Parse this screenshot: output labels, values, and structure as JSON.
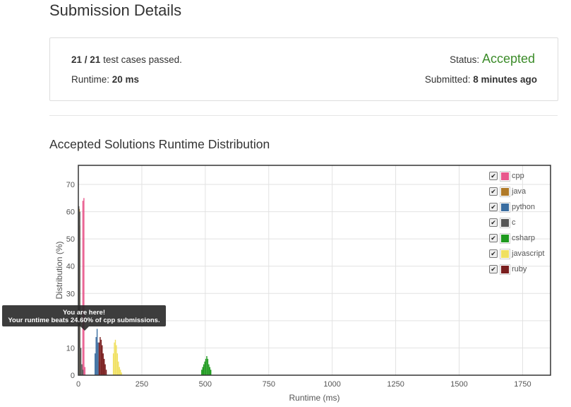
{
  "page": {
    "title": "Submission Details",
    "section_title": "Accepted Solutions Runtime Distribution"
  },
  "details": {
    "passed": "21",
    "slash": " / ",
    "total": "21",
    "passed_suffix": " test cases passed.",
    "runtime_label": "Runtime: ",
    "runtime_value": "20 ms",
    "status_label": "Status: ",
    "status_value": "Accepted",
    "submitted_label": "Submitted: ",
    "submitted_value": "8 minutes ago"
  },
  "tooltip": {
    "line1": "You are here!",
    "line2": "Your runtime beats 24.60% of cpp submissions."
  },
  "legend": [
    {
      "name": "cpp",
      "color": "#e8588c",
      "checked": true
    },
    {
      "name": "java",
      "color": "#b07a28",
      "checked": true
    },
    {
      "name": "python",
      "color": "#3a6da0",
      "checked": true
    },
    {
      "name": "c",
      "color": "#555555",
      "checked": true
    },
    {
      "name": "csharp",
      "color": "#1f9a1f",
      "checked": true
    },
    {
      "name": "javascript",
      "color": "#f0e060",
      "checked": true
    },
    {
      "name": "ruby",
      "color": "#7a1f1f",
      "checked": true
    }
  ],
  "chart_data": {
    "type": "bar",
    "xlabel": "Runtime (ms)",
    "ylabel": "Distribution (%)",
    "xlim": [
      0,
      1860
    ],
    "ylim": [
      0,
      77
    ],
    "x_ticks": [
      0,
      250,
      500,
      750,
      1000,
      1250,
      1500,
      1750
    ],
    "y_ticks": [
      0,
      10,
      20,
      30,
      40,
      50,
      60,
      70
    ],
    "grid": true,
    "legend_position": "top-right",
    "series": [
      {
        "name": "cpp",
        "x": [
          16,
          20,
          24
        ],
        "values": [
          64,
          65,
          3
        ]
      },
      {
        "name": "java",
        "x": [
          2,
          4,
          6
        ],
        "values": [
          61,
          55,
          8
        ]
      },
      {
        "name": "c",
        "x": [
          0,
          4,
          8,
          12,
          16
        ],
        "values": [
          62,
          60,
          10,
          4,
          2
        ]
      },
      {
        "name": "python",
        "x": [
          64,
          68,
          72,
          76,
          80
        ],
        "values": [
          8,
          14,
          17,
          12,
          5
        ]
      },
      {
        "name": "ruby",
        "x": [
          80,
          84,
          88,
          92,
          96,
          100,
          104,
          108
        ],
        "values": [
          12,
          14,
          13,
          11,
          8,
          6,
          4,
          2
        ]
      },
      {
        "name": "javascript",
        "x": [
          136,
          140,
          144,
          148,
          152,
          156,
          160,
          164,
          168
        ],
        "values": [
          8,
          12,
          13,
          11,
          8,
          5,
          3,
          2,
          1
        ]
      },
      {
        "name": "csharp",
        "x": [
          484,
          488,
          492,
          496,
          500,
          504,
          508,
          512,
          516,
          520
        ],
        "values": [
          2,
          3,
          4,
          5,
          6,
          7,
          6,
          4,
          3,
          2
        ]
      }
    ]
  }
}
